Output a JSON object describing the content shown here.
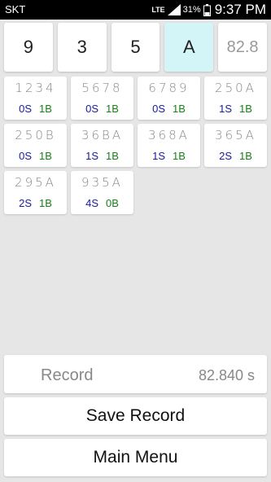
{
  "status_bar": {
    "carrier": "SKT",
    "network": "LTE",
    "battery": "31%",
    "time": "9:37 PM"
  },
  "current_guess": {
    "digits": [
      "9",
      "3",
      "5",
      "A"
    ],
    "active_index": 3,
    "timer": "82.8"
  },
  "history": [
    {
      "guess": "1234",
      "strikes": "0S",
      "balls": "1B"
    },
    {
      "guess": "5678",
      "strikes": "0S",
      "balls": "1B"
    },
    {
      "guess": "6789",
      "strikes": "0S",
      "balls": "1B"
    },
    {
      "guess": "250A",
      "strikes": "1S",
      "balls": "1B"
    },
    {
      "guess": "250B",
      "strikes": "0S",
      "balls": "1B"
    },
    {
      "guess": "36BA",
      "strikes": "1S",
      "balls": "1B"
    },
    {
      "guess": "368A",
      "strikes": "1S",
      "balls": "1B"
    },
    {
      "guess": "365A",
      "strikes": "2S",
      "balls": "1B"
    },
    {
      "guess": "295A",
      "strikes": "2S",
      "balls": "1B"
    },
    {
      "guess": "935A",
      "strikes": "4S",
      "balls": "0B"
    }
  ],
  "record": {
    "label": "Record",
    "value": "82.840 s"
  },
  "buttons": {
    "save": "Save Record",
    "main_menu": "Main Menu"
  },
  "colors": {
    "strike": "#1a1aa0",
    "ball": "#178217",
    "active_cell": "#d4f5f7",
    "background": "#e6e6e6"
  }
}
